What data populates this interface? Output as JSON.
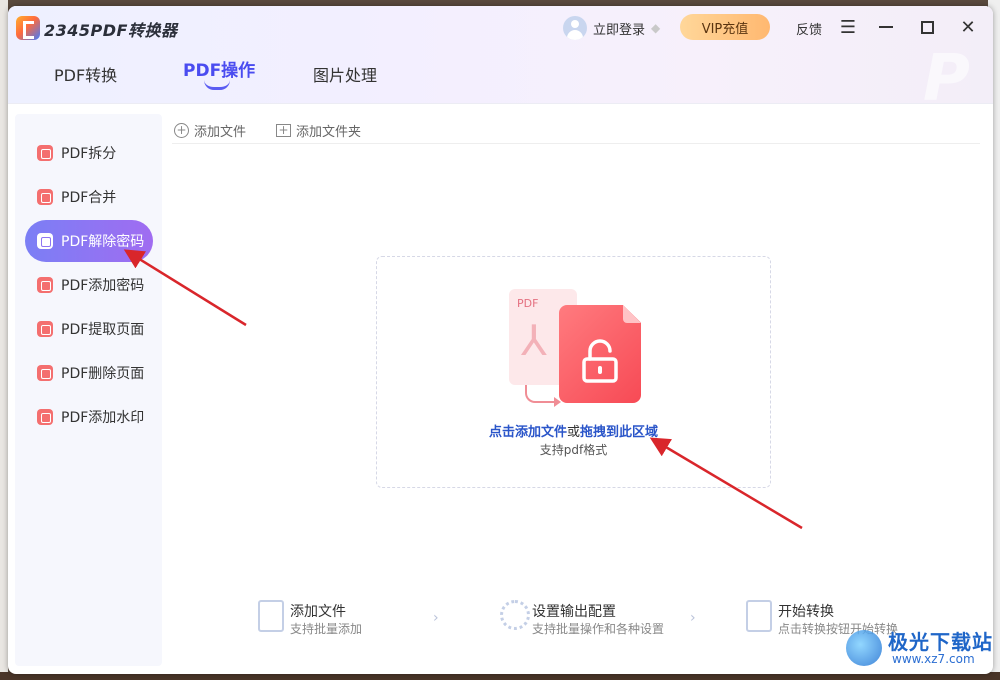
{
  "app": {
    "title": "2345PDF转换器",
    "login_label": "立即登录",
    "vip_label": "VIP充值",
    "feedback_label": "反馈"
  },
  "tabs": [
    {
      "label": "PDF转换",
      "active": false
    },
    {
      "label": "PDF操作",
      "active": true
    },
    {
      "label": "图片处理",
      "active": false
    }
  ],
  "sidebar": {
    "items": [
      {
        "label": "PDF拆分",
        "active": false
      },
      {
        "label": "PDF合并",
        "active": false
      },
      {
        "label": "PDF解除密码",
        "active": true
      },
      {
        "label": "PDF添加密码",
        "active": false
      },
      {
        "label": "PDF提取页面",
        "active": false
      },
      {
        "label": "PDF删除页面",
        "active": false
      },
      {
        "label": "PDF添加水印",
        "active": false
      }
    ]
  },
  "toolbar": {
    "add_file": "添加文件",
    "add_folder": "添加文件夹"
  },
  "dropzone": {
    "file_label": "PDF",
    "click_text": "点击添加文件",
    "or_text": "或",
    "drag_text": "拖拽到此区域",
    "support_text": "支持pdf格式"
  },
  "steps": [
    {
      "title": "添加文件",
      "subtitle": "支持批量添加"
    },
    {
      "title": "设置输出配置",
      "subtitle": "支持批量操作和各种设置"
    },
    {
      "title": "开始转换",
      "subtitle": "点击转换按钮开始转换"
    }
  ],
  "watermark": {
    "title": "极光下载站",
    "url": "www.xz7.com"
  },
  "colors": {
    "accent": "#4a4cf0",
    "active_gradient_start": "#7b7ff5",
    "active_gradient_end": "#a06cf1",
    "vip": "#ffc078",
    "icon_red": "#f74a55",
    "link_blue": "#2a55c9",
    "annotation_arrow": "#d9262b"
  },
  "icons": {
    "menu": "hamburger-icon",
    "minimize": "minimize-icon",
    "maximize": "maximize-icon",
    "close": "close-icon",
    "diamond": "diamond-icon"
  }
}
